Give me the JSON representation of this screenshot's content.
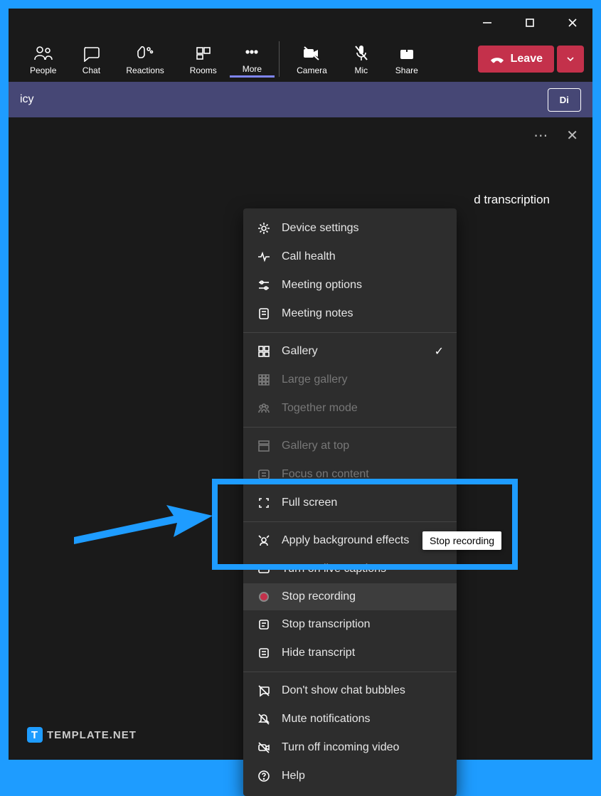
{
  "toolbar": {
    "people": "People",
    "chat": "Chat",
    "reactions": "Reactions",
    "rooms": "Rooms",
    "more": "More",
    "camera": "Camera",
    "mic": "Mic",
    "share": "Share",
    "leave": "Leave"
  },
  "meeting_bar": {
    "title_partial": "icy",
    "button_partial": "Di"
  },
  "side": {
    "text_partial": "d transcription"
  },
  "menu": {
    "s1": [
      {
        "label": "Device settings",
        "key": "device-settings"
      },
      {
        "label": "Call health",
        "key": "call-health"
      },
      {
        "label": "Meeting options",
        "key": "meeting-options"
      },
      {
        "label": "Meeting notes",
        "key": "meeting-notes"
      }
    ],
    "s2": [
      {
        "label": "Gallery",
        "key": "gallery",
        "checked": true
      },
      {
        "label": "Large gallery",
        "key": "large-gallery",
        "disabled": true
      },
      {
        "label": "Together mode",
        "key": "together-mode",
        "disabled": true
      }
    ],
    "s3": [
      {
        "label": "Gallery at top",
        "key": "gallery-at-top",
        "disabled": true
      },
      {
        "label": "Focus on content",
        "key": "focus-on-content",
        "disabled": true
      },
      {
        "label": "Full screen",
        "key": "full-screen"
      }
    ],
    "s4": [
      {
        "label": "Apply background effects",
        "key": "background-effects"
      },
      {
        "label": "Turn on live captions",
        "key": "live-captions"
      },
      {
        "label": "Stop recording",
        "key": "stop-recording",
        "hover": true
      },
      {
        "label": "Stop transcription",
        "key": "stop-transcription"
      },
      {
        "label": "Hide transcript",
        "key": "hide-transcript"
      }
    ],
    "s5": [
      {
        "label": "Don't show chat bubbles",
        "key": "chat-bubbles"
      },
      {
        "label": "Mute notifications",
        "key": "mute-notifications"
      },
      {
        "label": "Turn off incoming video",
        "key": "incoming-video"
      },
      {
        "label": "Help",
        "key": "help"
      }
    ]
  },
  "tooltip": "Stop recording",
  "watermark": "TEMPLATE.NET"
}
